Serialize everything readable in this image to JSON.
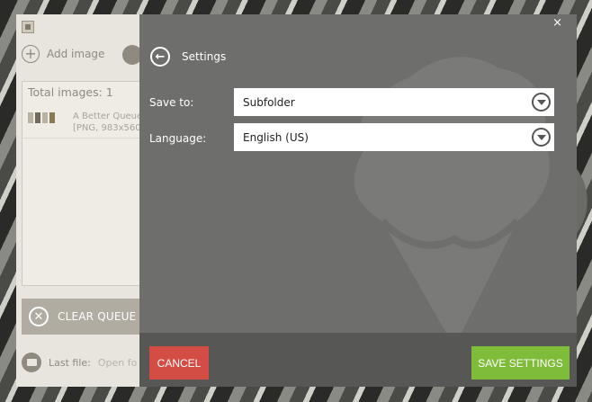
{
  "app": {
    "add_image_label": "Add image",
    "total_images": "Total images: 1",
    "queue": [
      {
        "name": "A Better Queue",
        "info": "[PNG, 983x560"
      }
    ],
    "clear_queue_label": "CLEAR QUEUE",
    "last_file_label": "Last file:",
    "last_file_value": "Open fo"
  },
  "settings": {
    "title": "Settings",
    "close_glyph": "×",
    "save_to_label": "Save to:",
    "save_to_value": "Subfolder",
    "language_label": "Language:",
    "language_value": "English (US)",
    "cancel_label": "CANCEL",
    "save_label": "SAVE SETTINGS"
  },
  "icons": {
    "add": "plus-circle-icon",
    "back": "arrow-left-circle-icon",
    "dropdown": "chevron-down-circle-icon",
    "clear": "x-circle-icon",
    "folder": "folder-icon"
  },
  "colors": {
    "cancel": "#d34d45",
    "save": "#7fbc3a",
    "overlay": "#6e6e6c"
  }
}
